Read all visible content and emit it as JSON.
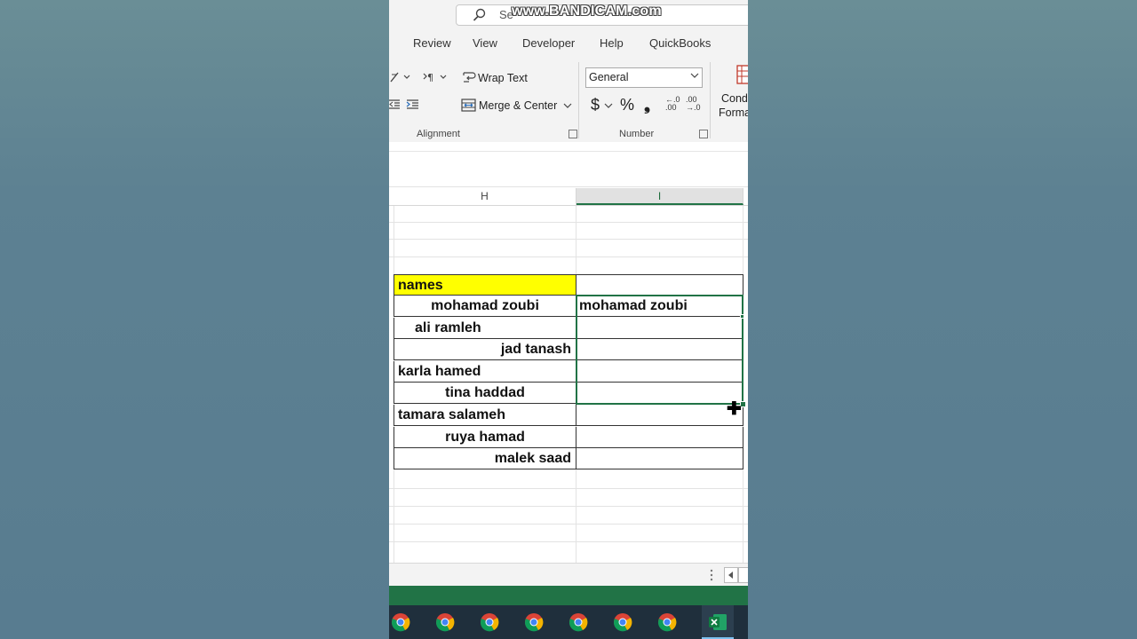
{
  "watermark": "www.BANDICAM.com",
  "search": {
    "placeholder": "Se"
  },
  "tabs": [
    "Review",
    "View",
    "Developer",
    "Help",
    "QuickBooks"
  ],
  "ribbon": {
    "wrap_text": "Wrap Text",
    "merge_center": "Merge & Center",
    "number_format": "General",
    "alignment_label": "Alignment",
    "number_label": "Number",
    "cond_format_line1": "Cond",
    "cond_format_line2": "Forma",
    "currency_symbol": "$",
    "percent_symbol": "%",
    "comma_symbol": "❟",
    "increase_decimal": "←.0 .00",
    "decrease_decimal": ".00 →.0"
  },
  "columns": {
    "h": "H",
    "i": "I"
  },
  "cells": {
    "header": "names",
    "rows": [
      {
        "h": "mohamad zoubi",
        "h_align": "center",
        "i": "mohamad zoubi"
      },
      {
        "h": "ali ramleh",
        "h_align": "indent",
        "i": ""
      },
      {
        "h": "jad tanash",
        "h_align": "right",
        "i": ""
      },
      {
        "h": "karla hamed",
        "h_align": "left",
        "i": ""
      },
      {
        "h": "tina haddad",
        "h_align": "center",
        "i": ""
      },
      {
        "h": "tamara salameh",
        "h_align": "left",
        "i": ""
      },
      {
        "h": "ruya hamad",
        "h_align": "center",
        "i": ""
      },
      {
        "h": "malek saad",
        "h_align": "right",
        "i": ""
      }
    ]
  },
  "colors": {
    "accent": "#217346",
    "header_fill": "#ffff00"
  },
  "taskbar_icons": [
    "chrome-icon",
    "chrome-icon",
    "chrome-icon",
    "chrome-icon",
    "chrome-icon",
    "chrome-icon",
    "chrome-icon",
    "excel-icon"
  ]
}
